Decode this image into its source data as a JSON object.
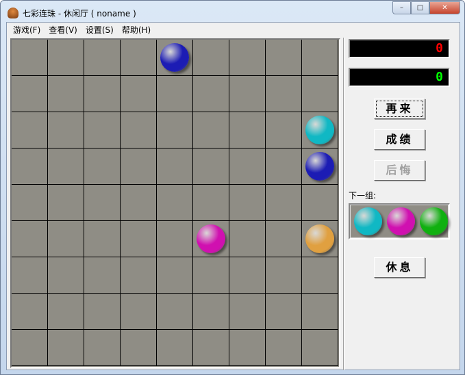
{
  "window": {
    "title": "七彩连珠 - 休闲厅 ( noname )",
    "minimize": "–",
    "maximize": "□",
    "close": "✕"
  },
  "menu": [
    "游戏(F)",
    "查看(V)",
    "设置(S)",
    "帮助(H)"
  ],
  "colors": {
    "blue": "#1c1cb4",
    "cyan": "#10b8c4",
    "magenta": "#d010b0",
    "orange": "#e0a040",
    "green": "#10b010",
    "score_red": "#ff0000",
    "score_green": "#00ff00"
  },
  "scores": {
    "score": "0",
    "high": "0"
  },
  "buttons": {
    "again": "再来",
    "records": "成绩",
    "undo": "后悔",
    "rest": "休息"
  },
  "next_label": "下一组:",
  "next_balls": [
    "cyan",
    "magenta",
    "green"
  ],
  "board": {
    "rows": 9,
    "cols": 9,
    "balls": [
      {
        "row": 0,
        "col": 4,
        "color": "blue"
      },
      {
        "row": 2,
        "col": 8,
        "color": "cyan"
      },
      {
        "row": 3,
        "col": 8,
        "color": "blue"
      },
      {
        "row": 5,
        "col": 5,
        "color": "magenta"
      },
      {
        "row": 5,
        "col": 8,
        "color": "orange"
      }
    ]
  }
}
